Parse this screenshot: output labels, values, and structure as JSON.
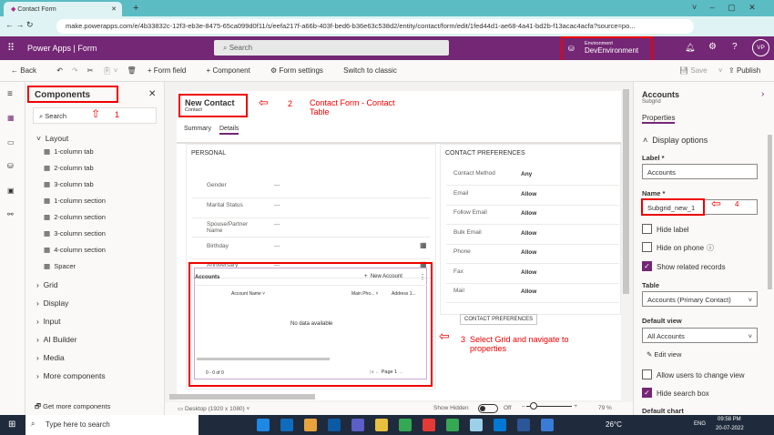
{
  "browser": {
    "tab_title": "Contact Form",
    "url": "make.powerapps.com/e/4b33832c-12f3-eb3e-8475-65ca099d0f11/s/eefa217f-a66b-403f-bed6-b36e63c538d2/entity/contact/form/edit/1fed44d1-ae68-4a41-bd2b-f13acac4acfa?source=po..."
  },
  "app": {
    "title": "Power Apps  |  Form",
    "search_placeholder": "Search",
    "env_label": "Environment",
    "env_name": "DevEnvironment",
    "avatar": "VP"
  },
  "commands": {
    "back": "Back",
    "form_field": "Form field",
    "component": "Component",
    "form_settings": "Form settings",
    "switch": "Switch to classic",
    "save": "Save",
    "publish": "Publish"
  },
  "components": {
    "title": "Components",
    "search": "Search",
    "layout": "Layout",
    "items": [
      "1-column tab",
      "2-column tab",
      "3-column tab",
      "1-column section",
      "2-column section",
      "3-column section",
      "4-column section",
      "Spacer"
    ],
    "groups": [
      "Grid",
      "Display",
      "Input",
      "AI Builder",
      "Media",
      "More components"
    ],
    "get_more": "Get more components"
  },
  "form": {
    "title": "New Contact",
    "subtitle": "Contact",
    "tabs": [
      "Summary",
      "Details"
    ],
    "personal": {
      "header": "PERSONAL",
      "fields": [
        {
          "label": "Gender",
          "value": "---"
        },
        {
          "label": "Marital Status",
          "value": "---"
        },
        {
          "label": "Spouse/Partner Name",
          "value": "---"
        },
        {
          "label": "Birthday",
          "value": "---"
        },
        {
          "label": "Anniversary",
          "value": "---"
        }
      ]
    },
    "subgrid": {
      "title": "Accounts",
      "new": "New Account",
      "cols": [
        "Account Name",
        "Main Pho...",
        "Address 1..."
      ],
      "empty": "No data available",
      "count": "0 - 0 of 0",
      "page": "Page 1"
    },
    "prefs": {
      "header": "CONTACT PREFERENCES",
      "fields": [
        {
          "label": "Contact Method",
          "value": "Any"
        },
        {
          "label": "Email",
          "value": "Allow"
        },
        {
          "label": "Follow Email",
          "value": "Allow"
        },
        {
          "label": "Bulk Email",
          "value": "Allow"
        },
        {
          "label": "Phone",
          "value": "Allow"
        },
        {
          "label": "Fax",
          "value": "Allow"
        },
        {
          "label": "Mail",
          "value": "Allow"
        }
      ],
      "tag": "CONTACT PREFERENCES"
    }
  },
  "annotations": {
    "a1": "1",
    "a2": "2",
    "a2text": "Contact Form - Contact Table",
    "a3": "3",
    "a3text": "Select Grid and navigate to properties",
    "a4": "4"
  },
  "props": {
    "title": "Accounts",
    "subtitle": "Subgrid",
    "tab": "Properties",
    "section": "Display options",
    "label_lbl": "Label *",
    "label_val": "Accounts",
    "name_lbl": "Name *",
    "name_val": "Subgrid_new_1",
    "hide_label": "Hide label",
    "hide_phone": "Hide on phone",
    "show_related": "Show related records",
    "table_lbl": "Table",
    "table_val": "Accounts (Primary Contact)",
    "view_lbl": "Default view",
    "view_val": "All Accounts",
    "edit_view": "Edit view",
    "allow_change": "Allow users to change view",
    "hide_search": "Hide search box",
    "chart_lbl": "Default chart"
  },
  "status": {
    "device": "Desktop (1920 x 1080)",
    "show_hidden": "Show Hidden",
    "toggle": "Off",
    "zoom": "79 %"
  },
  "taskbar": {
    "search": "Type here to search",
    "temp": "26°C",
    "lang": "ENG",
    "time": "09:58 PM",
    "date": "20-07-2022"
  }
}
